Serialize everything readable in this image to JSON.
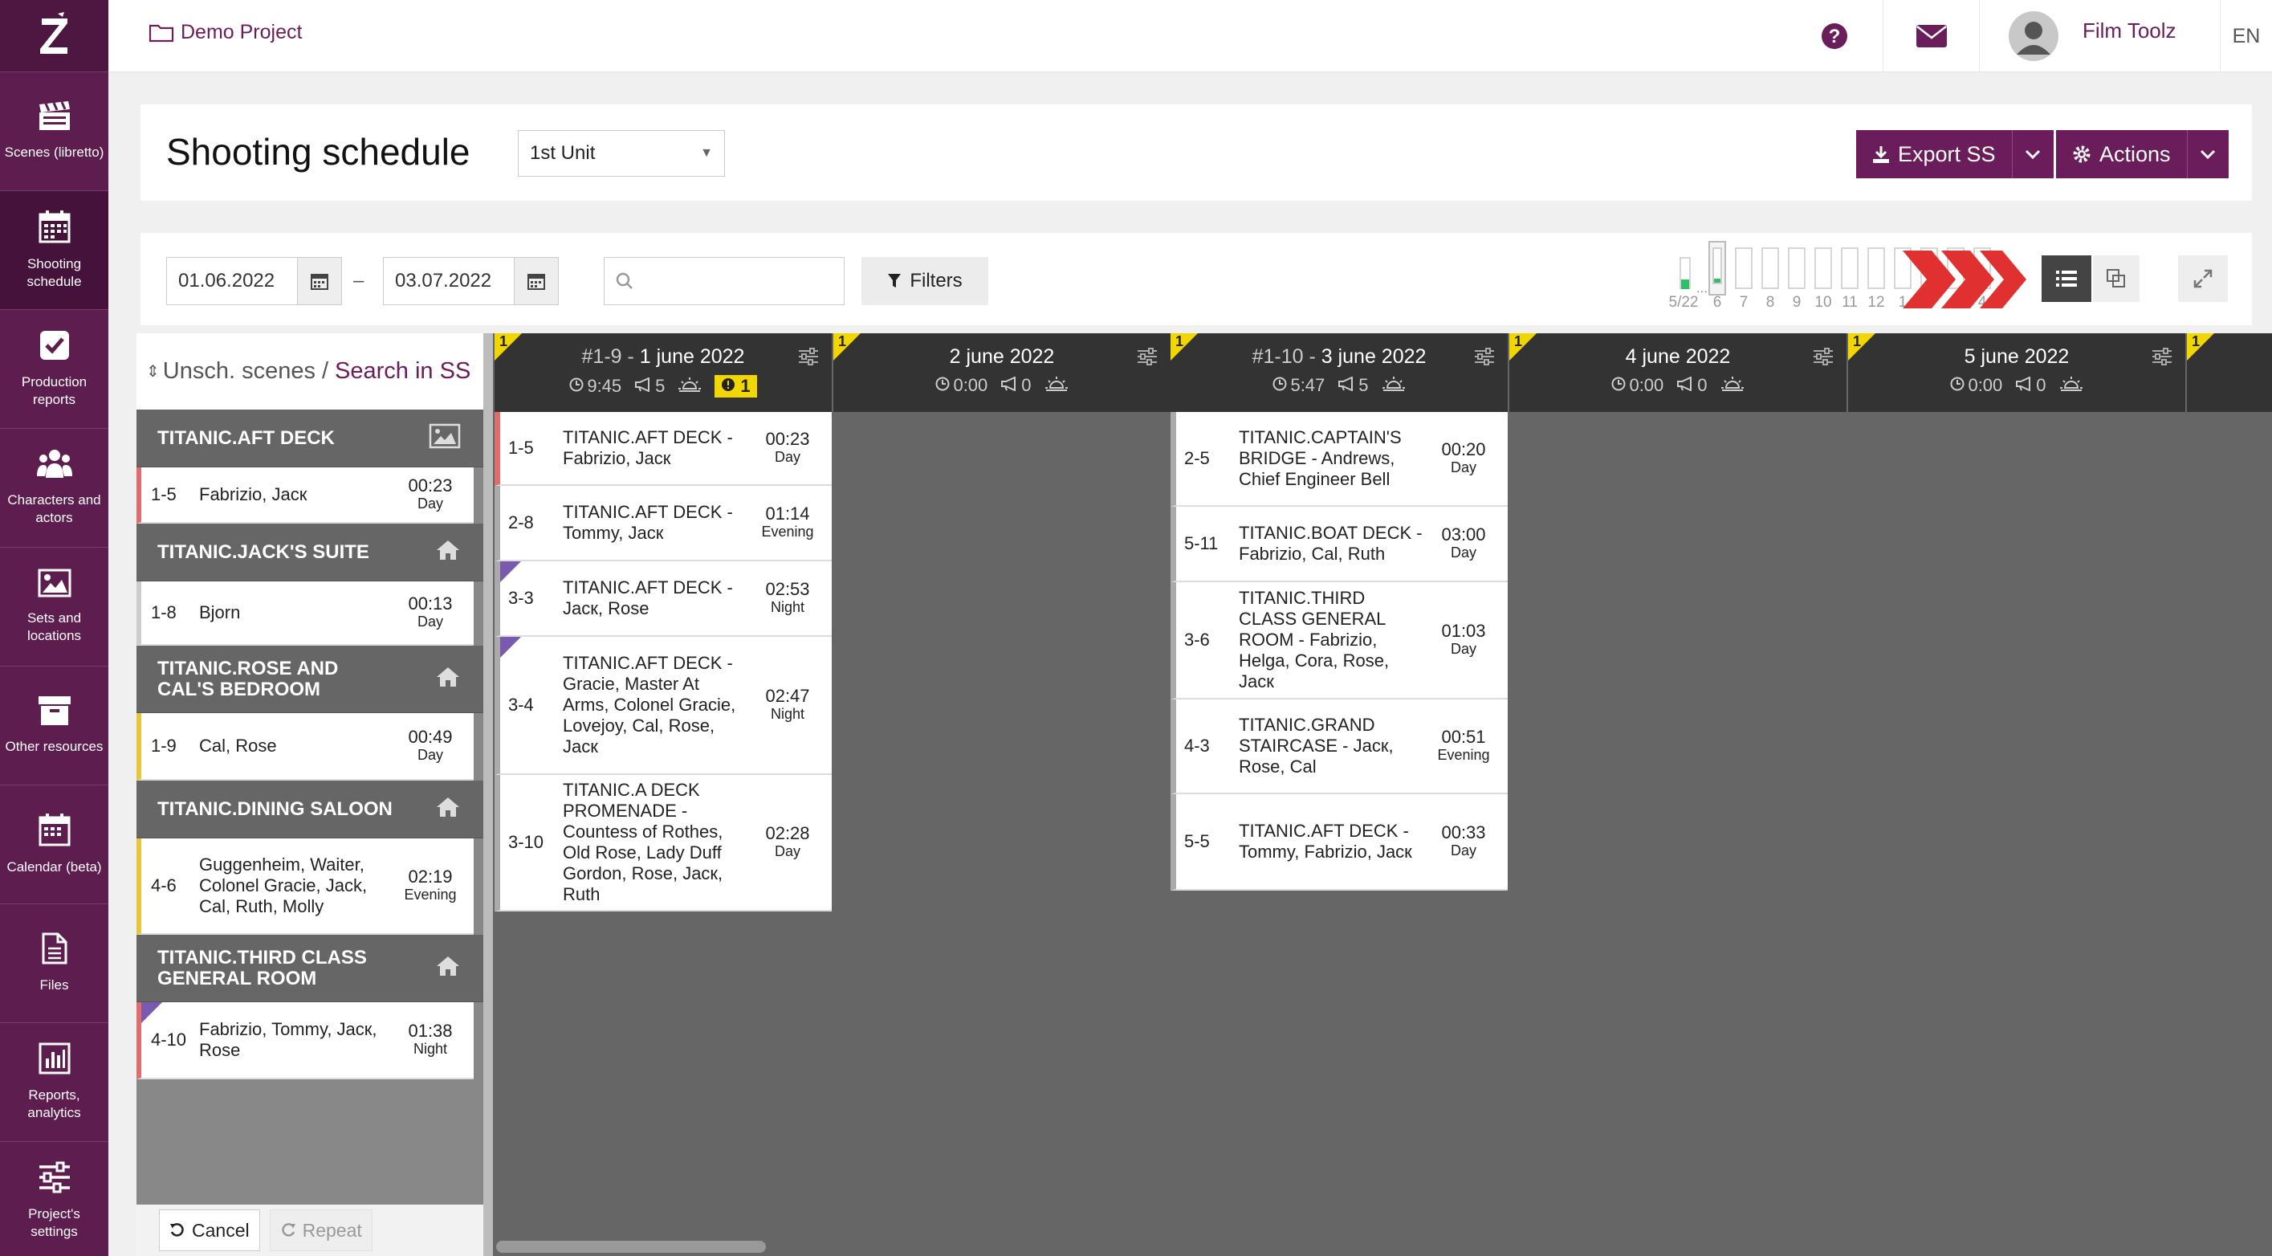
{
  "nav": {
    "items": [
      {
        "label": "Scenes (libretto)",
        "icon": "clapperboard-icon"
      },
      {
        "label": "Shooting schedule",
        "icon": "calendar-grid-icon"
      },
      {
        "label": "Production reports",
        "icon": "checkbox-icon"
      },
      {
        "label": "Characters and actors",
        "icon": "people-icon"
      },
      {
        "label": "Sets and locations",
        "icon": "image-icon"
      },
      {
        "label": "Other resources",
        "icon": "archive-icon"
      },
      {
        "label": "Calendar (beta)",
        "icon": "calendar-icon"
      },
      {
        "label": "Files",
        "icon": "file-icon"
      },
      {
        "label": "Reports, analytics",
        "icon": "bar-chart-icon"
      },
      {
        "label": "Project's settings",
        "icon": "sliders-icon"
      }
    ]
  },
  "topbar": {
    "project": "Demo Project",
    "user": "Film Toolz",
    "lang": "EN"
  },
  "header": {
    "title": "Shooting schedule",
    "unit": "1st Unit",
    "export_label": "Export SS",
    "actions_label": "Actions"
  },
  "toolbar": {
    "date_from": "01.06.2022",
    "date_sep": "–",
    "date_to": "03.07.2022",
    "search_placeholder": "",
    "filters_label": "Filters",
    "day_labels": [
      "5/22",
      "6",
      "7",
      "8",
      "9",
      "10",
      "11",
      "12",
      "1",
      "2",
      "3",
      "4"
    ]
  },
  "left": {
    "unsch_label": "Unsch. scenes",
    "slash": "/",
    "search_label": "Search in SS",
    "groups": [
      {
        "location": "TITANIC.AFT DECK",
        "scenes": [
          {
            "no": "1-5",
            "desc": "Fabrizio, Jacк",
            "time": "00:23",
            "tod": "Day"
          }
        ]
      },
      {
        "location": "TITANIC.JACK'S SUITE",
        "scenes": [
          {
            "no": "1-8",
            "desc": "Bjorn",
            "time": "00:13",
            "tod": "Day"
          }
        ]
      },
      {
        "location": "TITANIC.ROSE AND CAL'S BEDROOM",
        "scenes": [
          {
            "no": "1-9",
            "desc": "Cal, Rose",
            "time": "00:49",
            "tod": "Day"
          }
        ]
      },
      {
        "location": "TITANIC.DINING SALOON",
        "scenes": [
          {
            "no": "4-6",
            "desc": "Guggenheim, Waiter, Colonel Gracie, Jack, Cal, Ruth, Molly",
            "time": "02:19",
            "tod": "Evening"
          }
        ]
      },
      {
        "location": "TITANIC.THIRD CLASS GENERAL ROOM",
        "scenes": [
          {
            "no": "4-10",
            "desc": "Fabrizio, Tommy, Jacк, Rose",
            "time": "01:38",
            "tod": "Night"
          }
        ]
      }
    ],
    "cancel_label": "Cancel",
    "repeat_label": "Repeat"
  },
  "days": [
    {
      "flag": "1",
      "prefix": "#1-9 -",
      "date": "1 june 2022",
      "duration": "9:45",
      "scenes_count": "5",
      "warning": "1",
      "cards": [
        {
          "no": "1-5",
          "desc": "TITANIC.AFT DECK - Fabrizio, Jacк",
          "time": "00:23",
          "tod": "Day"
        },
        {
          "no": "2-8",
          "desc": "TITANIC.AFT DECK - Tommy, Jacк",
          "time": "01:14",
          "tod": "Evening"
        },
        {
          "no": "3-3",
          "desc": "TITANIC.AFT DECK - Jacк, Rose",
          "time": "02:53",
          "tod": "Night"
        },
        {
          "no": "3-4",
          "desc": "TITANIC.AFT DECK - Gracie, Master At Arms, Colonel Gracie, Lovejoy, Cal, Rose, Jacк",
          "time": "02:47",
          "tod": "Night"
        },
        {
          "no": "3-10",
          "desc": "TITANIC.A DECK PROMENADE - Countess of Rothes, Old Rose, Lady Duff Gordon, Rose, Jacк, Ruth",
          "time": "02:28",
          "tod": "Day"
        }
      ]
    },
    {
      "flag": "1",
      "prefix": "",
      "date": "2 june 2022",
      "duration": "0:00",
      "scenes_count": "0",
      "warning": "",
      "cards": []
    },
    {
      "flag": "1",
      "prefix": "#1-10 -",
      "date": "3 june 2022",
      "duration": "5:47",
      "scenes_count": "5",
      "warning": "",
      "cards": [
        {
          "no": "2-5",
          "desc": "TITANIC.CAPTAIN'S BRIDGE - Andrews, Chief Engineer Bell",
          "time": "00:20",
          "tod": "Day"
        },
        {
          "no": "5-11",
          "desc": "TITANIC.BOAT DECK - Fabrizio, Cal, Ruth",
          "time": "03:00",
          "tod": "Day"
        },
        {
          "no": "3-6",
          "desc": "TITANIC.THIRD CLASS GENERAL ROOM - Fabrizio, Helga, Cora, Rose, Jacк",
          "time": "01:03",
          "tod": "Day"
        },
        {
          "no": "4-3",
          "desc": "TITANIC.GRAND STAIRCASE - Jacк, Rose, Cal",
          "time": "00:51",
          "tod": "Evening"
        },
        {
          "no": "5-5",
          "desc": "TITANIC.AFT DECK - Tommy, Fabrizio, Jacк",
          "time": "00:33",
          "tod": "Day"
        }
      ]
    },
    {
      "flag": "1",
      "prefix": "",
      "date": "4 june 2022",
      "duration": "0:00",
      "scenes_count": "0",
      "warning": "",
      "cards": []
    },
    {
      "flag": "1",
      "prefix": "",
      "date": "5 june 2022",
      "duration": "0:00",
      "scenes_count": "0",
      "warning": "",
      "cards": []
    },
    {
      "flag": "1",
      "prefix": "",
      "date": "",
      "duration": "",
      "scenes_count": "",
      "warning": "",
      "cards": []
    }
  ],
  "colors": {
    "brand": "#6a1d5a",
    "accent_red": "#e03030",
    "flag_yellow": "#f2d600",
    "board_bg": "#666666"
  }
}
